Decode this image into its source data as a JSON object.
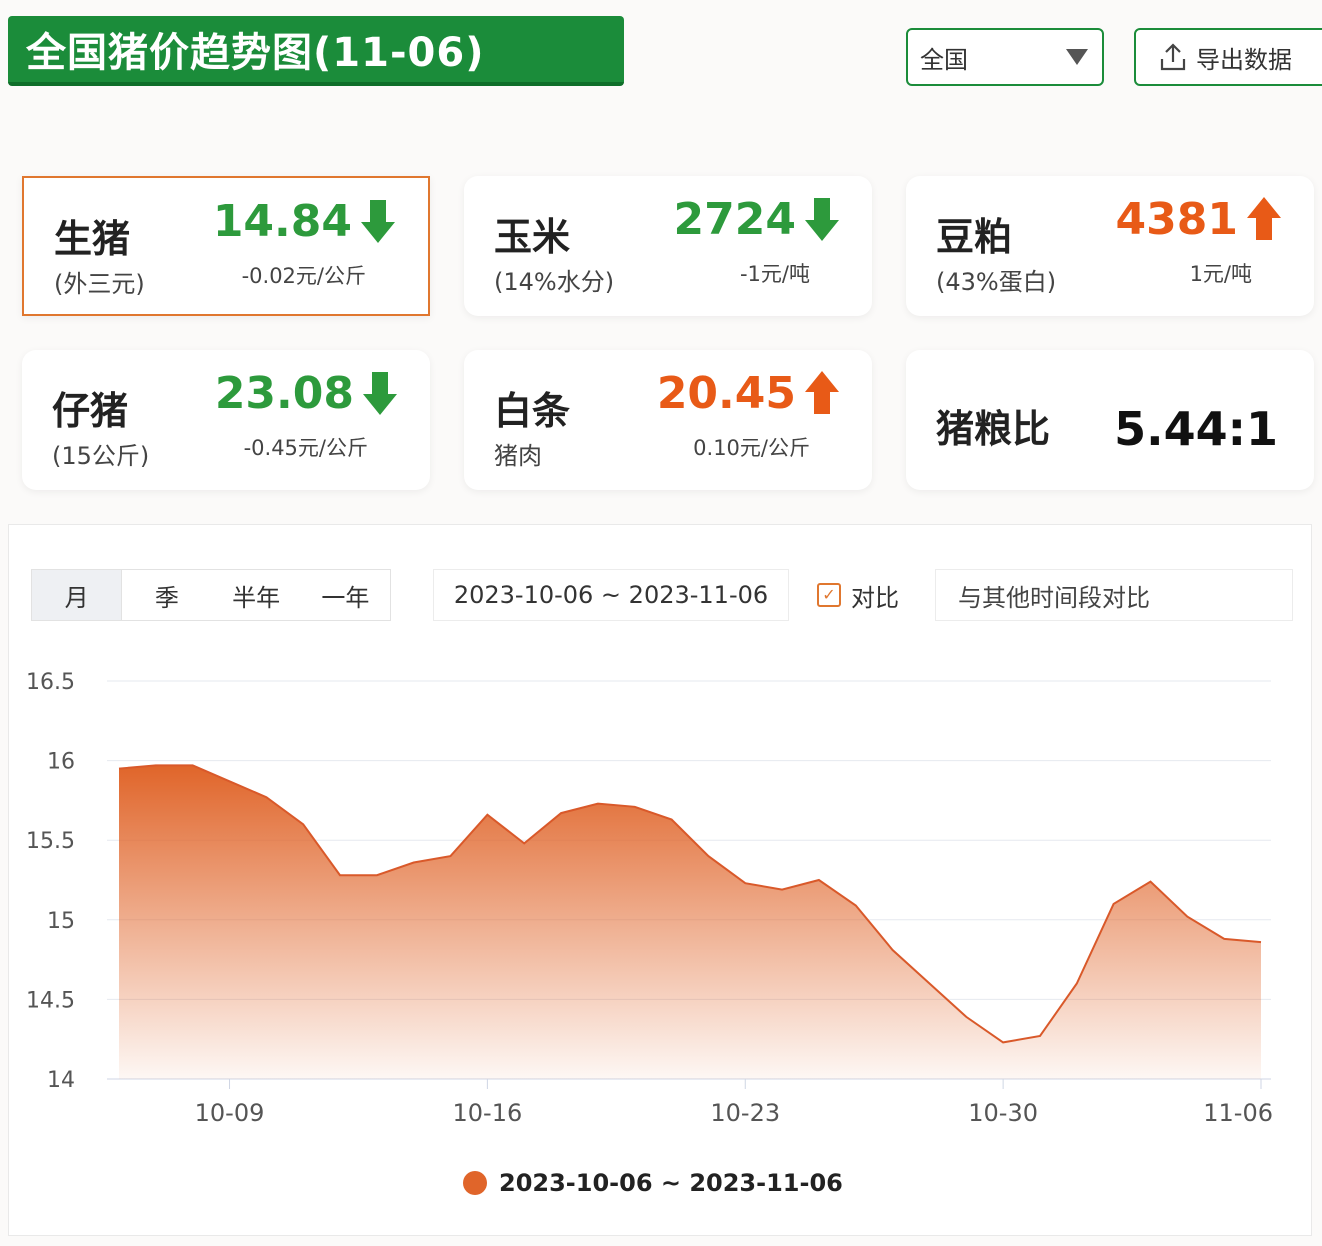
{
  "header": {
    "title": "全国猪价趋势图(11-06)",
    "region_value": "全国",
    "export_label": "导出数据"
  },
  "cards": [
    {
      "name": "生猪",
      "sub": "(外三元)",
      "price": "14.84",
      "trend": "down",
      "change": "-0.02元/公斤"
    },
    {
      "name": "玉米",
      "sub": "(14%水分)",
      "price": "2724",
      "trend": "down",
      "change": "-1元/吨"
    },
    {
      "name": "豆粕",
      "sub": "(43%蛋白)",
      "price": "4381",
      "trend": "up",
      "change": "1元/吨"
    },
    {
      "name": "仔猪",
      "sub": "(15公斤)",
      "price": "23.08",
      "trend": "down",
      "change": "-0.45元/公斤"
    },
    {
      "name": "白条",
      "sub": "猪肉",
      "price": "20.45",
      "trend": "up",
      "change": "0.10元/公斤"
    },
    {
      "name": "猪粮比",
      "ratio": "5.44:1"
    }
  ],
  "controls": {
    "periods": [
      "月",
      "季",
      "半年",
      "一年"
    ],
    "active_period": "月",
    "date_range": "2023-10-06 ~ 2023-11-06",
    "compare_label": "对比",
    "compare_checked": true,
    "compare_placeholder": "与其他时间段对比"
  },
  "colors": {
    "accent": "#1b8c3a",
    "down": "#2d9a3c",
    "up": "#e85a17",
    "area": "#e0652a"
  },
  "chart_data": {
    "type": "area",
    "x": [
      "2023-10-06",
      "2023-10-07",
      "2023-10-08",
      "2023-10-09",
      "2023-10-10",
      "2023-10-11",
      "2023-10-12",
      "2023-10-13",
      "2023-10-14",
      "2023-10-15",
      "2023-10-16",
      "2023-10-17",
      "2023-10-18",
      "2023-10-19",
      "2023-10-20",
      "2023-10-21",
      "2023-10-22",
      "2023-10-23",
      "2023-10-24",
      "2023-10-25",
      "2023-10-26",
      "2023-10-27",
      "2023-10-28",
      "2023-10-29",
      "2023-10-30",
      "2023-10-31",
      "2023-11-01",
      "2023-11-02",
      "2023-11-03",
      "2023-11-04",
      "2023-11-05",
      "2023-11-06"
    ],
    "series": [
      {
        "name": "2023-10-06 ~ 2023-11-06",
        "values": [
          15.95,
          15.97,
          15.97,
          15.87,
          15.77,
          15.6,
          15.28,
          15.28,
          15.36,
          15.4,
          15.66,
          15.48,
          15.67,
          15.73,
          15.71,
          15.63,
          15.4,
          15.23,
          15.19,
          15.25,
          15.09,
          14.81,
          14.6,
          14.39,
          14.23,
          14.27,
          14.6,
          15.1,
          15.24,
          15.02,
          14.88,
          14.86
        ]
      }
    ],
    "x_ticks": [
      "10-09",
      "10-16",
      "10-23",
      "10-30",
      "11-06"
    ],
    "y_ticks": [
      "14",
      "14.5",
      "15",
      "15.5",
      "16",
      "16.5"
    ],
    "ylim": [
      14,
      16.5
    ],
    "grid": true,
    "legend": "bottom-center"
  }
}
